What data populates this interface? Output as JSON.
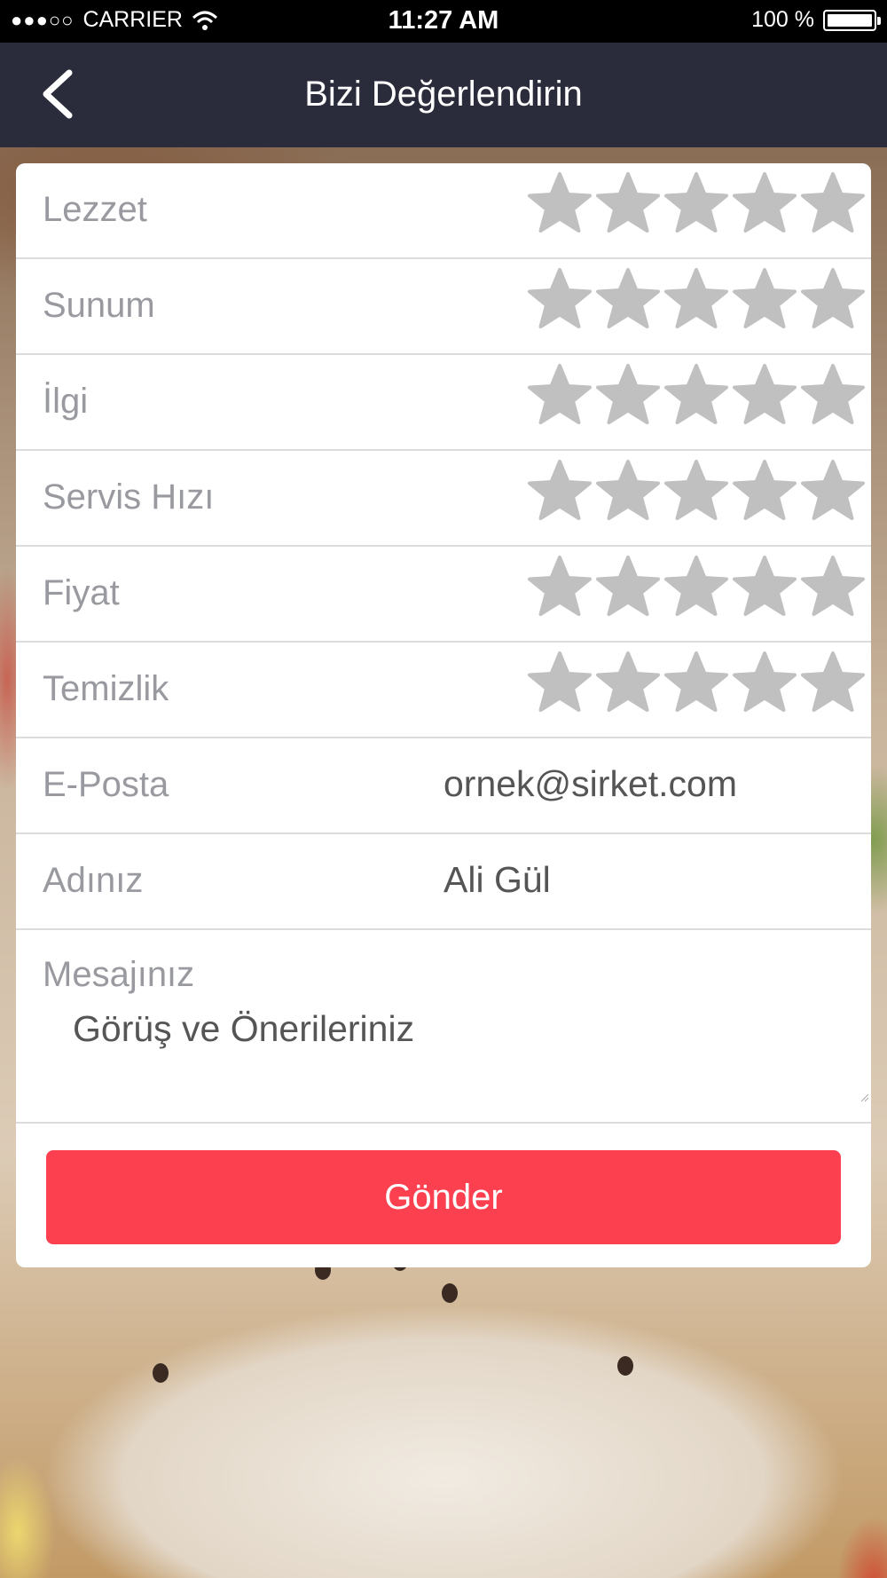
{
  "status_bar": {
    "signal_dots": "●●●○○",
    "carrier": "CARRIER",
    "time": "11:27 AM",
    "battery_text": "100 %"
  },
  "nav": {
    "title": "Bizi Değerlendirin",
    "back_icon": "chevron-left-icon"
  },
  "ratings": [
    {
      "label": "Lezzet",
      "stars": 0,
      "max": 5
    },
    {
      "label": "Sunum",
      "stars": 0,
      "max": 5
    },
    {
      "label": "İlgi",
      "stars": 0,
      "max": 5
    },
    {
      "label": "Servis Hızı",
      "stars": 0,
      "max": 5
    },
    {
      "label": "Fiyat",
      "stars": 0,
      "max": 5
    },
    {
      "label": "Temizlik",
      "stars": 0,
      "max": 5
    }
  ],
  "form": {
    "email": {
      "label": "E-Posta",
      "placeholder": "ornek@sirket.com"
    },
    "name": {
      "label": "Adınız",
      "placeholder": "Ali Gül"
    },
    "message": {
      "label": "Mesajınız",
      "placeholder": "Görüş ve Önerileriniz"
    }
  },
  "submit_label": "Gönder",
  "colors": {
    "nav_bg": "#2a2c3b",
    "submit_bg": "#fd404f",
    "star_empty": "#c0c0c0",
    "label_text": "#999aa0"
  }
}
